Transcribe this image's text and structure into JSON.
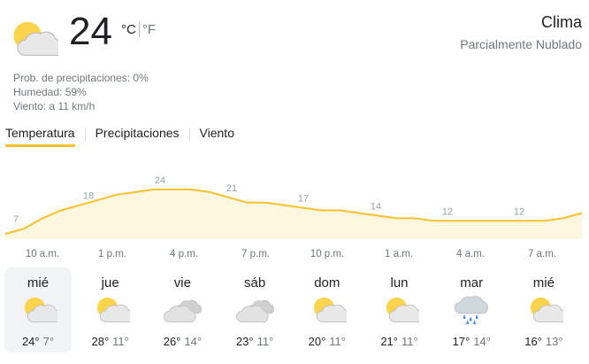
{
  "current": {
    "icon": "partly-cloudy-icon",
    "temperature": "24",
    "unit_c": "°C",
    "unit_f": "°F"
  },
  "header": {
    "title": "Clima",
    "condition": "Parcialmente Nublado"
  },
  "details": {
    "precipitation": "Prob. de precipitaciones: 0%",
    "humidity": "Humedad: 59%",
    "wind": "Viento: a 11 km/h"
  },
  "tabs": [
    {
      "label": "Temperatura",
      "active": true
    },
    {
      "label": "Precipitaciones",
      "active": false
    },
    {
      "label": "Viento",
      "active": false
    }
  ],
  "colors": {
    "accent": "#fbc02d",
    "chart_fill": "#fef7e0",
    "chart_line": "#fbc02d"
  },
  "chart_data": {
    "type": "area",
    "x": [
      "10 a.m.",
      "1 p.m.",
      "4 p.m.",
      "7 p.m.",
      "10 p.m.",
      "1 a.m.",
      "4 a.m.",
      "7 a.m."
    ],
    "labels": [
      7,
      18,
      24,
      21,
      17,
      14,
      12,
      12
    ],
    "hourly": [
      7,
      9,
      13,
      16,
      18,
      20,
      22,
      23,
      24,
      24,
      24,
      23,
      21,
      19,
      19,
      18,
      17,
      16,
      16,
      15,
      14,
      13,
      13,
      12,
      12,
      12,
      12,
      12,
      12,
      12,
      13,
      15
    ],
    "ylim": [
      5,
      26
    ],
    "grid": false,
    "legend": "none"
  },
  "days": [
    {
      "name": "mié",
      "icon": "partly-cloudy-icon",
      "high": "24°",
      "low": "7°",
      "selected": true
    },
    {
      "name": "jue",
      "icon": "partly-cloudy-icon",
      "high": "28°",
      "low": "11°",
      "selected": false
    },
    {
      "name": "vie",
      "icon": "cloudy-icon",
      "high": "26°",
      "low": "14°",
      "selected": false
    },
    {
      "name": "sáb",
      "icon": "cloudy-icon",
      "high": "23°",
      "low": "11°",
      "selected": false
    },
    {
      "name": "dom",
      "icon": "partly-cloudy-icon",
      "high": "20°",
      "low": "11°",
      "selected": false
    },
    {
      "name": "lun",
      "icon": "partly-cloudy-icon",
      "high": "21°",
      "low": "11°",
      "selected": false
    },
    {
      "name": "mar",
      "icon": "rain-icon",
      "high": "17°",
      "low": "14°",
      "selected": false
    },
    {
      "name": "mié",
      "icon": "partly-cloudy-icon",
      "high": "16°",
      "low": "13°",
      "selected": false
    }
  ]
}
